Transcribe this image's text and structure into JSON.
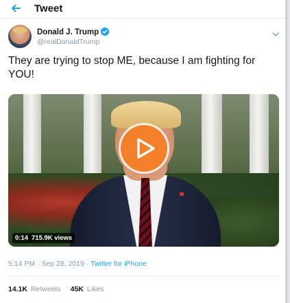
{
  "header": {
    "title": "Tweet"
  },
  "author": {
    "name": "Donald J. Trump",
    "handle": "@realDonaldTrump"
  },
  "tweet": {
    "text": "They are trying to stop ME, because I am fighting for YOU!"
  },
  "video": {
    "duration": "0:14",
    "views": "715.9K views"
  },
  "meta": {
    "time": "5:14 PM",
    "separator_1": " · ",
    "date": "Sep 28, 2019",
    "separator_2": " · ",
    "source": "Twitter for iPhone"
  },
  "stats": {
    "retweets_count": "14.1K",
    "retweets_label": "Retweets",
    "likes_count": "45K",
    "likes_label": "Likes"
  },
  "colors": {
    "accent": "#1da1f2",
    "play_button": "#f4802a",
    "verified": "#1da1f2"
  },
  "icons": {
    "back": "back-arrow-icon",
    "verified": "verified-badge-icon",
    "menu": "chevron-down-icon",
    "play": "play-icon"
  }
}
